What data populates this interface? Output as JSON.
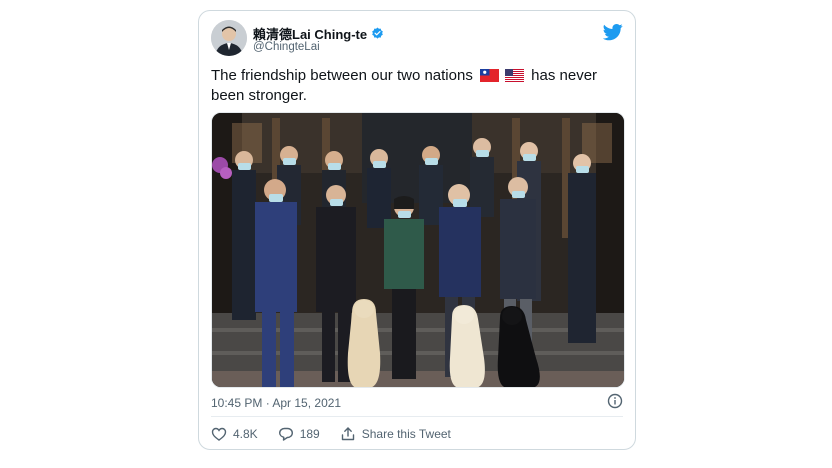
{
  "author": {
    "display_name": "賴清德Lai Ching-te",
    "handle": "@ChingteLai"
  },
  "tweet": {
    "text_before": "The friendship between our two nations",
    "text_after": "has never been stronger.",
    "flags": [
      "taiwan-flag",
      "usa-flag"
    ]
  },
  "meta": {
    "timestamp": "10:45 PM · Apr 15, 2021"
  },
  "actions": {
    "likes": "4.8K",
    "replies": "189",
    "share_label": "Share this Tweet"
  },
  "colors": {
    "twitter_blue": "#1d9bf0",
    "secondary_text": "#536471",
    "border": "#cfd9de"
  }
}
